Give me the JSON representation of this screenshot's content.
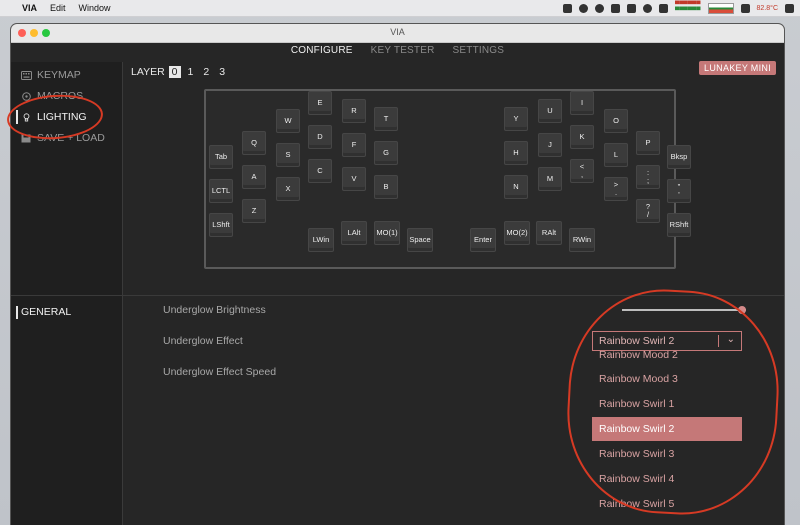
{
  "menubar": {
    "apple": "",
    "app": "VIA",
    "items": [
      "Edit",
      "Window"
    ],
    "temp": "82.8°C",
    "indicator_top": "▀▀▀▀▀▀",
    "indicator_bottom": "▀▀▀▀▀▀"
  },
  "window": {
    "title": "VIA",
    "tabs": [
      {
        "label": "CONFIGURE",
        "active": true
      },
      {
        "label": "KEY TESTER",
        "active": false
      },
      {
        "label": "SETTINGS",
        "active": false
      }
    ]
  },
  "sidebar": {
    "items": [
      {
        "label": "KEYMAP",
        "icon": "keyboard-icon"
      },
      {
        "label": "MACROS",
        "icon": "macro-icon"
      },
      {
        "label": "LIGHTING",
        "icon": "bulb-icon"
      },
      {
        "label": "SAVE + LOAD",
        "icon": "save-icon"
      }
    ],
    "general": "GENERAL"
  },
  "layer": {
    "label": "LAYER",
    "numbers": [
      "0",
      "1",
      "2",
      "3"
    ],
    "selected": 0
  },
  "keyboard_name": "LUNAKEY MINI",
  "keys": {
    "tab": "Tab",
    "q": "Q",
    "w": "W",
    "e": "E",
    "r": "R",
    "t": "T",
    "lctl": "LCTL",
    "a": "A",
    "s": "S",
    "d": "D",
    "f": "F",
    "g": "G",
    "lshft": "LShft",
    "z": "Z",
    "x": "X",
    "c": "C",
    "v": "V",
    "b": "B",
    "lwin": "LWin",
    "lalt": "LAlt",
    "mo1": "MO(1)",
    "space": "Space",
    "y": "Y",
    "u": "U",
    "i": "I",
    "o": "O",
    "p": "P",
    "bksp": "Bksp",
    "h": "H",
    "j": "J",
    "k": "K",
    "l": "L",
    "semi": ":\n;",
    "quote": "\"\n'",
    "n": "N",
    "m": "M",
    "comma": "<\n,",
    "period": ">\n.",
    "slash": "?\n/",
    "rshft": "RShft",
    "enter": "Enter",
    "mo2": "MO(2)",
    "ralt": "RAlt",
    "rwin": "RWin"
  },
  "settings": {
    "brightness_label": "Underglow Brightness",
    "brightness_value": 1.0,
    "effect_label": "Underglow Effect",
    "speed_label": "Underglow Effect Speed",
    "effect_selected": "Rainbow Swirl 2",
    "options": [
      "Rainbow Mood 2",
      "Rainbow Mood 3",
      "Rainbow Swirl 1",
      "Rainbow Swirl 2",
      "Rainbow Swirl 3",
      "Rainbow Swirl 4",
      "Rainbow Swirl 5"
    ],
    "selected_index": 3
  },
  "colors": {
    "accent": "#c57878",
    "annotation": "#d63a24"
  }
}
